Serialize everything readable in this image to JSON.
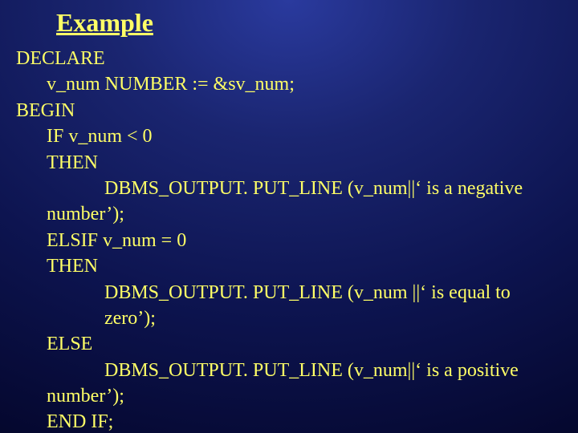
{
  "slide": {
    "title": "Example",
    "lines": {
      "l0": "DECLARE",
      "l1": "v_num NUMBER := &sv_num;",
      "l2": "BEGIN",
      "l3": "IF v_num < 0",
      "l4": "THEN",
      "l5": "DBMS_OUTPUT. PUT_LINE (v_num||‘ is a negative",
      "l5b": "number’);",
      "l6": "ELSIF v_num = 0",
      "l7": "THEN",
      "l8": "DBMS_OUTPUT. PUT_LINE (v_num ||‘ is equal to zero’);",
      "l9": "ELSE",
      "l10": "DBMS_OUTPUT. PUT_LINE (v_num||‘ is a positive",
      "l10b": "number’);",
      "l11": "END IF;"
    }
  }
}
